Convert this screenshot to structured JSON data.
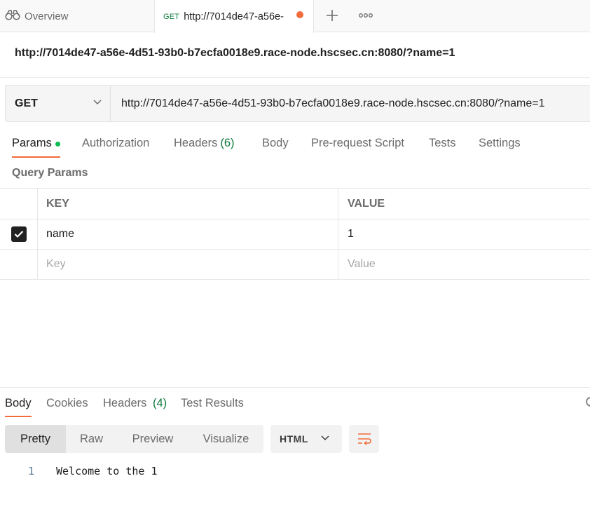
{
  "tabs": {
    "overview": {
      "label": "Overview",
      "icon": "binoculars-icon"
    },
    "active": {
      "method": "GET",
      "url": "http://7014de47-a56e-",
      "unsaved_color": "#f26b3a"
    }
  },
  "request": {
    "title": "http://7014de47-a56e-4d51-93b0-b7ecfa0018e9.race-node.hscsec.cn:8080/?name=1",
    "method": "GET",
    "url": "http://7014de47-a56e-4d51-93b0-b7ecfa0018e9.race-node.hscsec.cn:8080/?name=1"
  },
  "request_tabs": [
    {
      "label": "Params",
      "count": ""
    },
    {
      "label": "Authorization",
      "count": ""
    },
    {
      "label": "Headers",
      "count": "(6)"
    },
    {
      "label": "Body",
      "count": ""
    },
    {
      "label": "Pre-request Script",
      "count": ""
    },
    {
      "label": "Tests",
      "count": ""
    },
    {
      "label": "Settings",
      "count": ""
    }
  ],
  "query_params": {
    "section_label": "Query Params",
    "headers": {
      "key": "KEY",
      "value": "VALUE"
    },
    "rows": [
      {
        "checked": true,
        "key": "name",
        "value": "1"
      }
    ],
    "placeholder": {
      "key": "Key",
      "value": "Value"
    }
  },
  "response_tabs": [
    {
      "label": "Body",
      "count": ""
    },
    {
      "label": "Cookies",
      "count": ""
    },
    {
      "label": "Headers",
      "count": "(4)"
    },
    {
      "label": "Test Results",
      "count": ""
    }
  ],
  "response_view": {
    "modes": [
      "Pretty",
      "Raw",
      "Preview",
      "Visualize"
    ],
    "selected_mode": "Pretty",
    "language": "HTML"
  },
  "response_body": [
    {
      "line": "1",
      "text": "Welcome to the 1"
    }
  ],
  "colors": {
    "accent": "#f26b3a",
    "green": "#0f7b3d",
    "params_dot": "#0cbb52"
  }
}
